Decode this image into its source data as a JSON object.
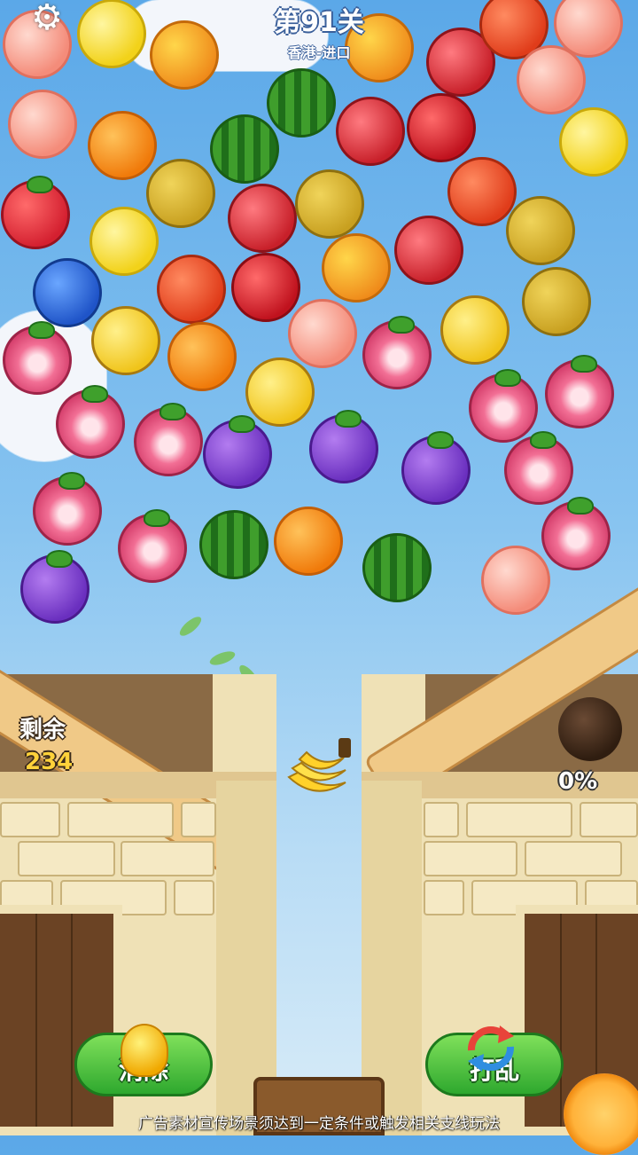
{
  "header": {
    "settings_icon": "gear-icon",
    "level_title": "第91关",
    "level_subtitle": "香港-进口"
  },
  "counters": {
    "remaining_label": "剩余",
    "remaining_value": "234",
    "progress_text": "0%"
  },
  "buttons": {
    "eliminate_label": "消除",
    "eliminate_icon": "lightbulb-icon",
    "shuffle_label": "打乱",
    "shuffle_icon": "shuffle-icon"
  },
  "disclaimer": "广告素材宣传场景须达到一定条件或触发相关支线玩法",
  "current_shot": "banana",
  "colors": {
    "sky_top": "#5ba8e8",
    "button_green": "#2ea82e",
    "counter_yellow": "#ffd23a"
  },
  "fruits": [
    {
      "kind": "peach"
    },
    {
      "kind": "lemon"
    },
    {
      "kind": "mango"
    },
    {
      "kind": "mango"
    },
    {
      "kind": "pomegranate"
    },
    {
      "kind": "tomato"
    },
    {
      "kind": "peach"
    },
    {
      "kind": "peach"
    },
    {
      "kind": "orange"
    },
    {
      "kind": "watermelon"
    },
    {
      "kind": "watermelon"
    },
    {
      "kind": "pomegranate"
    },
    {
      "kind": "apple"
    },
    {
      "kind": "peach"
    },
    {
      "kind": "lemon"
    },
    {
      "kind": "strawberry"
    },
    {
      "kind": "durian"
    },
    {
      "kind": "pomegranate"
    },
    {
      "kind": "durian"
    },
    {
      "kind": "tomato"
    },
    {
      "kind": "durian"
    },
    {
      "kind": "lemon"
    },
    {
      "kind": "blueberry"
    },
    {
      "kind": "tomato"
    },
    {
      "kind": "apple"
    },
    {
      "kind": "mango"
    },
    {
      "kind": "pomegranate"
    },
    {
      "kind": "durian"
    },
    {
      "kind": "banana"
    },
    {
      "kind": "orange"
    },
    {
      "kind": "peach"
    },
    {
      "kind": "dragonfruit"
    },
    {
      "kind": "banana"
    },
    {
      "kind": "dragonfruit"
    },
    {
      "kind": "banana"
    },
    {
      "kind": "dragonfruit"
    },
    {
      "kind": "dragonfruit"
    },
    {
      "kind": "dragonfruit"
    },
    {
      "kind": "dragonfruit"
    },
    {
      "kind": "grape"
    },
    {
      "kind": "grape"
    },
    {
      "kind": "grape"
    },
    {
      "kind": "dragonfruit"
    },
    {
      "kind": "dragonfruit"
    },
    {
      "kind": "dragonfruit"
    },
    {
      "kind": "watermelon"
    },
    {
      "kind": "orange"
    },
    {
      "kind": "watermelon"
    },
    {
      "kind": "dragonfruit"
    },
    {
      "kind": "grape"
    },
    {
      "kind": "peach"
    }
  ]
}
